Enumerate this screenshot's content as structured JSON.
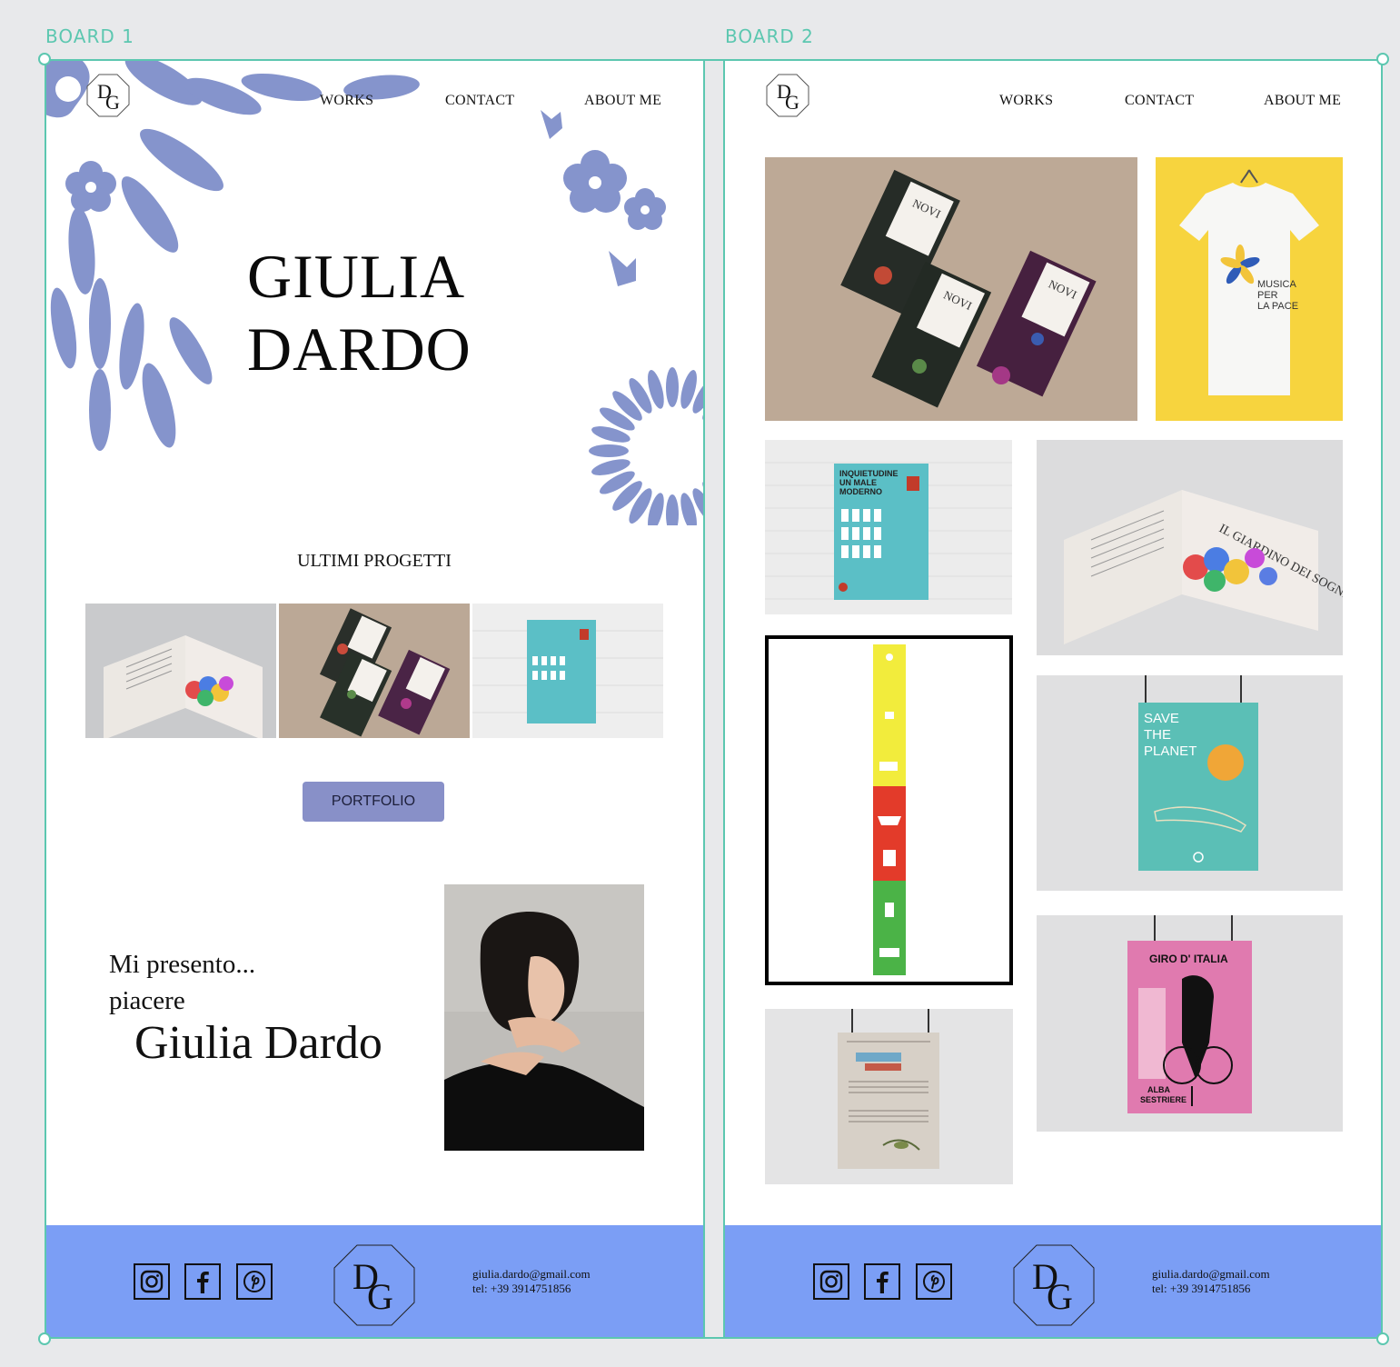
{
  "labels": {
    "board1": "BOARD 1",
    "board2": "BOARD 2"
  },
  "nav": {
    "works": "WORKS",
    "contact": "CONTACT",
    "about": "ABOUT ME"
  },
  "logo_text": "DG",
  "hero": {
    "line1": "GIULIA",
    "line2": "DARDO"
  },
  "projects": {
    "title": "ULTIMI PROGETTI"
  },
  "portfolio_button": "PORTFOLIO",
  "intro": {
    "line1": "Mi presento...",
    "line2": "piacere",
    "name": "Giulia Dardo"
  },
  "footer": {
    "email": "giulia.dardo@gmail.com",
    "tel": "tel: +39 3914751856"
  },
  "gallery": {
    "book_title": "IL GIARDINO DEI SOGNI",
    "chocolate_brand": "NOVI",
    "tshirt_text": [
      "MUSICA",
      "PER",
      "LA PACE"
    ],
    "poster1_title": [
      "INQUIETUDINE",
      "UN MALE",
      "MODERNO"
    ],
    "poster2_title": [
      "SAVE",
      "THE",
      "PLANET"
    ],
    "poster3_title": "GIRO D' ITALIA",
    "poster3_sub": [
      "ALBA",
      "SESTRIERE"
    ]
  },
  "colors": {
    "accent_teal": "#5cc7b0",
    "flower_blue": "#8594cc",
    "footer_blue": "#7b9ef5",
    "button": "#8890c8",
    "tshirt_bg": "#f7d43e",
    "poster_teal": "#5bbfb6",
    "poster_pink": "#e07aaf"
  }
}
